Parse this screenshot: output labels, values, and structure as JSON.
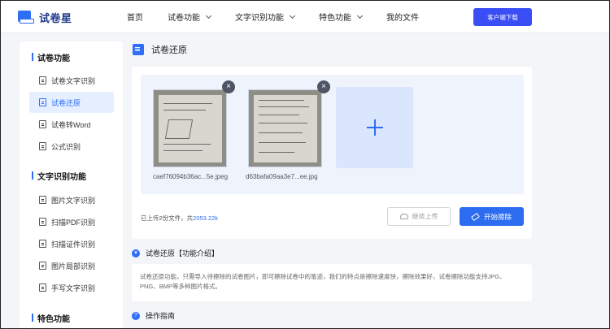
{
  "header": {
    "logo": "试卷星",
    "nav": [
      "首页",
      "试卷功能",
      "文字识别功能",
      "特色功能",
      "我的文件"
    ],
    "nav_dropdown": [
      false,
      true,
      true,
      true,
      false
    ],
    "download_label": "客户端下载"
  },
  "sidebar": {
    "group1": "试卷功能",
    "group1_items": [
      "试卷文字识别",
      "试卷还原",
      "试卷转Word",
      "公式识别"
    ],
    "group2": "文字识别功能",
    "group2_items": [
      "图片文字识别",
      "扫描PDF识别",
      "扫描证件识别",
      "图片局部识别",
      "手写文字识别"
    ],
    "group3": "特色功能",
    "active": "试卷还原"
  },
  "main": {
    "title": "试卷还原",
    "files": [
      {
        "name": "caef76094b36ac...5e.jpeg"
      },
      {
        "name": "d63bafa09aa3e7...ee.jpg"
      }
    ],
    "status_prefix": "已上传2份文件，共",
    "status_size": "2053.22k",
    "continue_label": "继续上传",
    "start_label": "开始擦除",
    "intro_title": "试卷还原【功能介绍】",
    "intro_text": "试卷还原功能，只需导入待擦除的试卷图片，即可擦除试卷中的笔迹，我们的特点是擦除速度快，擦除效果好，试卷擦除功能支持JPG、PNG、BMP等多种图片格式。",
    "guide_title": "操作指南"
  },
  "colors": {
    "accent": "#2f6ef6",
    "download": "#3b4ef5",
    "active_bg": "#e5efff"
  }
}
